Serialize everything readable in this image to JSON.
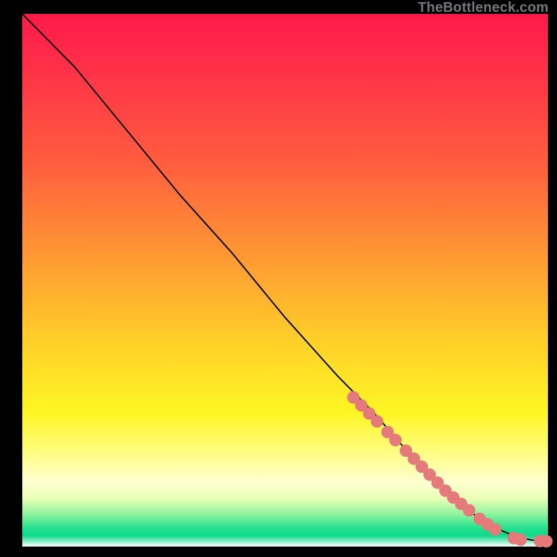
{
  "watermark": "TheBottleneck.com",
  "colors": {
    "curve": "#000000",
    "marker_fill": "#e47a7a",
    "marker_stroke": "#c85a5a"
  },
  "chart_data": {
    "type": "line",
    "title": "",
    "xlabel": "",
    "ylabel": "",
    "xlim": [
      0,
      100
    ],
    "ylim": [
      0,
      100
    ],
    "series": [
      {
        "name": "curve",
        "x": [
          0,
          4,
          10,
          20,
          30,
          40,
          50,
          60,
          67,
          74,
          80,
          86,
          90,
          94,
          97,
          100
        ],
        "y": [
          100,
          96,
          90,
          78,
          66,
          55,
          43,
          32,
          25,
          17,
          11,
          6,
          3.5,
          1.8,
          1.2,
          1.0
        ]
      }
    ],
    "markers": [
      {
        "x": 63,
        "y": 28
      },
      {
        "x": 64.5,
        "y": 26.5
      },
      {
        "x": 66,
        "y": 25
      },
      {
        "x": 67.5,
        "y": 23.5
      },
      {
        "x": 69.5,
        "y": 21.5
      },
      {
        "x": 71,
        "y": 20
      },
      {
        "x": 73,
        "y": 18
      },
      {
        "x": 74.5,
        "y": 16.5
      },
      {
        "x": 76,
        "y": 15
      },
      {
        "x": 77.5,
        "y": 13.5
      },
      {
        "x": 79,
        "y": 12
      },
      {
        "x": 80.5,
        "y": 10.5
      },
      {
        "x": 82,
        "y": 9.2
      },
      {
        "x": 83.5,
        "y": 8
      },
      {
        "x": 85,
        "y": 6.8
      },
      {
        "x": 87,
        "y": 5.2
      },
      {
        "x": 88.5,
        "y": 4.2
      },
      {
        "x": 90,
        "y": 3.2
      },
      {
        "x": 93.5,
        "y": 1.6
      },
      {
        "x": 94.8,
        "y": 1.3
      },
      {
        "x": 98.5,
        "y": 1.05
      },
      {
        "x": 99.7,
        "y": 1.0
      }
    ]
  }
}
